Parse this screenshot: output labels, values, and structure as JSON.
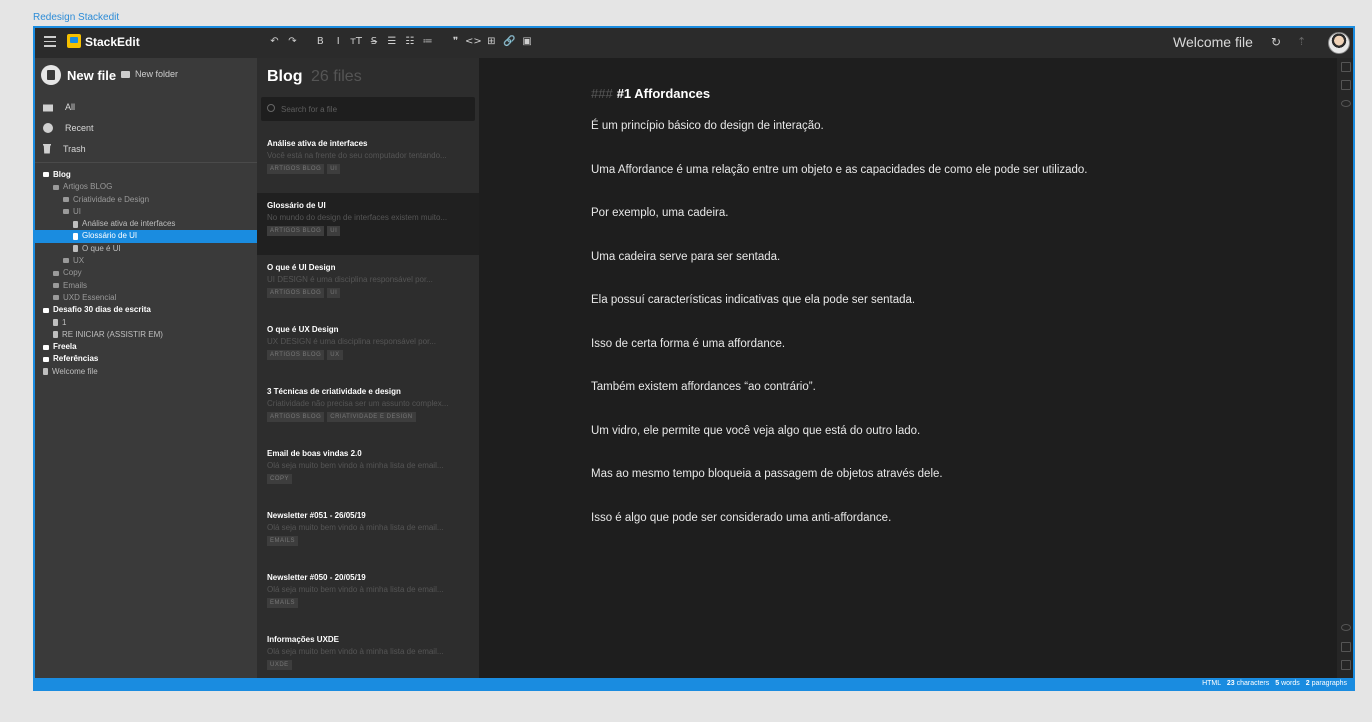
{
  "frame_label": "Redesign Stackedit",
  "topbar": {
    "brand": "StackEdit",
    "toolbar": [
      "↶",
      "↷",
      "B",
      "I",
      "ᴛT",
      "S̶",
      "☰",
      "☷",
      "≔",
      "❞",
      "<>",
      "⊞",
      "🔗",
      "▣"
    ],
    "file_title": "Welcome file",
    "sync_icon": "↻",
    "upload_icon": "⇡"
  },
  "sidebar": {
    "new_file": "New file",
    "new_folder": "New folder",
    "nav": [
      {
        "label": "All",
        "icon": "inbox-icon"
      },
      {
        "label": "Recent",
        "icon": "clock-icon"
      },
      {
        "label": "Trash",
        "icon": "trash-icon"
      }
    ],
    "tree": [
      {
        "label": "Blog",
        "level": 0,
        "type": "folder",
        "bold": true
      },
      {
        "label": "Artigos BLOG",
        "level": 1,
        "type": "folder"
      },
      {
        "label": "Criatividade e Design",
        "level": 2,
        "type": "folder"
      },
      {
        "label": "UI",
        "level": 2,
        "type": "folder"
      },
      {
        "label": "Análise ativa de interfaces",
        "level": 3,
        "type": "file"
      },
      {
        "label": "Glossário de UI",
        "level": 3,
        "type": "file",
        "selected": true
      },
      {
        "label": "O que é UI",
        "level": 3,
        "type": "file"
      },
      {
        "label": "UX",
        "level": 2,
        "type": "folder"
      },
      {
        "label": "Copy",
        "level": 1,
        "type": "folder"
      },
      {
        "label": "Emails",
        "level": 1,
        "type": "folder"
      },
      {
        "label": "UXD Essencial",
        "level": 1,
        "type": "folder"
      },
      {
        "label": "Desafio 30 dias de escrita",
        "level": 0,
        "type": "folder",
        "bold": true
      },
      {
        "label": "1",
        "level": 1,
        "type": "file"
      },
      {
        "label": "RE INICIAR (ASSISTIR EM)",
        "level": 1,
        "type": "file"
      },
      {
        "label": "Freela",
        "level": 0,
        "type": "folder",
        "bold": true
      },
      {
        "label": "Referências",
        "level": 0,
        "type": "folder",
        "bold": true
      },
      {
        "label": "Welcome file",
        "level": 0,
        "type": "file"
      }
    ]
  },
  "filelist": {
    "title": "Blog",
    "count": "26 files",
    "search_placeholder": "Search for a file",
    "items": [
      {
        "name": "Análise ativa de interfaces",
        "snippet": "Você está na frente do seu computador tentando...",
        "tags": [
          "ARTIGOS BLOG",
          "UI"
        ]
      },
      {
        "name": "Glossário de UI",
        "snippet": "No mundo do design de interfaces existem muito...",
        "tags": [
          "ARTIGOS BLOG",
          "UI"
        ],
        "active": true
      },
      {
        "name": "O que é UI Design",
        "snippet": "UI DESIGN é uma disciplina responsável por...",
        "tags": [
          "ARTIGOS BLOG",
          "UI"
        ]
      },
      {
        "name": "O que é UX Design",
        "snippet": "UX DESIGN é uma disciplina responsável por...",
        "tags": [
          "ARTIGOS BLOG",
          "UX"
        ]
      },
      {
        "name": "3 Técnicas de criatividade e design",
        "snippet": "Criatividade não precisa ser um assunto complex...",
        "tags": [
          "ARTIGOS BLOG",
          "CRIATIVIDADE E DESIGN"
        ]
      },
      {
        "name": "Email de boas vindas 2.0",
        "snippet": "Olá seja muito bem vindo à minha lista de email...",
        "tags": [
          "COPY"
        ]
      },
      {
        "name": "Newsletter #051 - 26/05/19",
        "snippet": "Olá seja muito bem vindo à minha lista de email...",
        "tags": [
          "EMAILS"
        ]
      },
      {
        "name": "Newsletter #050 - 20/05/19",
        "snippet": "Olá seja muito bem vindo à minha lista de email...",
        "tags": [
          "EMAILS"
        ]
      },
      {
        "name": "Informações UXDE",
        "snippet": "Olá seja muito bem vindo à minha lista de email...",
        "tags": [
          "UXDE"
        ]
      }
    ]
  },
  "editor": {
    "heading_hashes": "###",
    "heading": "#1 Affordances",
    "paragraphs": [
      "É um princípio básico do design de interação.",
      "Uma Affordance é uma relação entre um objeto e as capacidades de como ele pode ser utilizado.",
      "Por exemplo, uma cadeira.",
      "Uma cadeira serve para ser sentada.",
      "Ela possuí características indicativas que ela pode ser sentada.",
      "Isso de certa forma é uma affordance.",
      "Também existem affordances “ao contrário”.",
      "Um vidro, ele permite que você veja algo que está do outro lado.",
      "Mas ao mesmo tempo bloqueia a passagem de objetos através dele.",
      "Isso é algo que pode ser considerado uma anti-affordance."
    ]
  },
  "statusbar": {
    "format": "HTML",
    "characters_num": "23",
    "characters_label": "characters",
    "words_num": "5",
    "words_label": "words",
    "paragraphs_num": "2",
    "paragraphs_label": "paragraphs"
  },
  "colors": {
    "accent": "#1a8ce0",
    "logo": "#f5c000"
  }
}
